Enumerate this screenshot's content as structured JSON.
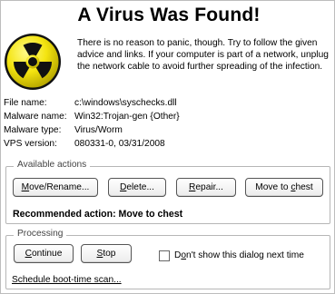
{
  "dialog": {
    "title": "A Virus Was Found!",
    "icon": "radiation-hazard-icon",
    "message": "There is no reason to panic, though. Try to follow the given advice and links. If your computer is part of a network, unplug the network cable to avoid further spreading of the infection."
  },
  "info": [
    {
      "label": "File name:",
      "value": "c:\\windows\\syschecks.dll"
    },
    {
      "label": "Malware name:",
      "value": "Win32:Trojan-gen {Other}"
    },
    {
      "label": "Malware type:",
      "value": "Virus/Worm"
    },
    {
      "label": "VPS version:",
      "value": "080331-0, 03/31/2008"
    }
  ],
  "actions": {
    "group_title": "Available actions",
    "buttons": {
      "move_rename": {
        "key": "M",
        "rest": "ove/Rename..."
      },
      "delete": {
        "key": "D",
        "rest": "elete..."
      },
      "repair": {
        "key": "R",
        "rest": "epair..."
      },
      "move_to_chest": {
        "pre": "Move to ",
        "key": "c",
        "post": "hest"
      }
    },
    "recommended": "Recommended action: Move to chest"
  },
  "processing": {
    "group_title": "Processing",
    "continue": {
      "key": "C",
      "rest": "ontinue"
    },
    "stop": {
      "key": "S",
      "rest": "top"
    },
    "checkbox": {
      "pre": "D",
      "key": "o",
      "post": "n't show this dialog next time",
      "checked": false
    },
    "link": "Schedule boot-time scan..."
  },
  "colors": {
    "hazard_yellow": "#f4e410",
    "hazard_black": "#111111"
  }
}
